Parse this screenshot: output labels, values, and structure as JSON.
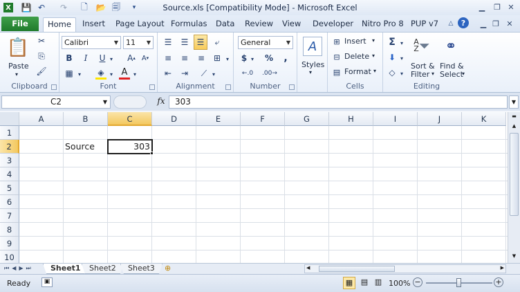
{
  "window": {
    "title": "Source.xls  [Compatibility Mode]  -  Microsoft Excel"
  },
  "tabs": {
    "file": "File",
    "items": [
      "Home",
      "Insert",
      "Page Layout",
      "Formulas",
      "Data",
      "Review",
      "View",
      "Developer",
      "Nitro Pro 8",
      "PUP v7"
    ]
  },
  "ribbon": {
    "clipboard": {
      "label": "Clipboard",
      "paste": "Paste"
    },
    "font": {
      "label": "Font",
      "name": "Calibri",
      "size": "11"
    },
    "alignment": {
      "label": "Alignment"
    },
    "number": {
      "label": "Number",
      "format": "General",
      "currency": "$",
      "percent": "%",
      "comma": ","
    },
    "styles": {
      "label": "Styles"
    },
    "cells": {
      "label": "Cells",
      "insert": "Insert",
      "delete": "Delete",
      "format": "Format"
    },
    "editing": {
      "label": "Editing",
      "sort1": "Sort &",
      "sort2": "Filter",
      "find1": "Find &",
      "find2": "Select"
    }
  },
  "formula_bar": {
    "name_box": "C2",
    "fx": "fx",
    "value": "303"
  },
  "columns": [
    "A",
    "B",
    "C",
    "D",
    "E",
    "F",
    "G",
    "H",
    "I",
    "J",
    "K"
  ],
  "rows": [
    "1",
    "2",
    "3",
    "4",
    "5",
    "6",
    "7",
    "8",
    "9",
    "10"
  ],
  "cells": {
    "B2": "Source",
    "C2": "303"
  },
  "sheets": [
    "Sheet1",
    "Sheet2",
    "Sheet3"
  ],
  "status": {
    "mode": "Ready",
    "zoom": "100%",
    "zoom_level": 1.0
  }
}
